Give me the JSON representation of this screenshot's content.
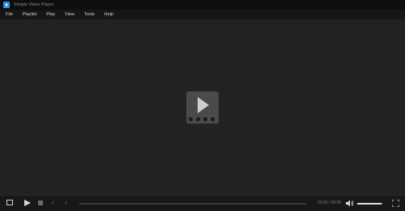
{
  "window": {
    "title": "Simple Video Player"
  },
  "menu": [
    {
      "label": "File"
    },
    {
      "label": "Playlist"
    },
    {
      "label": "Play"
    },
    {
      "label": "View"
    },
    {
      "label": "Tools"
    },
    {
      "label": "Help"
    }
  ],
  "controls": {
    "time": "00:00 / 00:00",
    "seek_progress": 0.0,
    "volume_level": 0.95,
    "prev_glyph": "‹",
    "next_glyph": "›"
  },
  "colors": {
    "accent": "#2f8fe6",
    "background": "#222222",
    "overlay": "#4a4a4a"
  },
  "icons": [
    "app-icon",
    "play-overlay-icon",
    "aspect-ratio-icon",
    "play-icon",
    "stop-icon",
    "previous-icon",
    "next-icon",
    "volume-icon",
    "fullscreen-icon"
  ]
}
